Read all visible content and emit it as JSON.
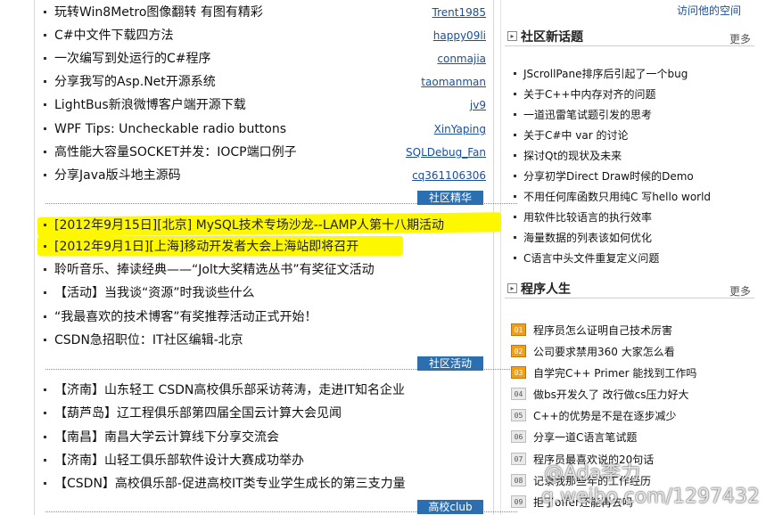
{
  "left_sections": [
    {
      "items": [
        {
          "title": "玩转Win8Metro图像翻转 有图有精彩",
          "author": "Trent1985"
        },
        {
          "title": "C#中文件下载四方法",
          "author": "happy09li"
        },
        {
          "title": "一次编写到处运行的C#程序",
          "author": "conmajia"
        },
        {
          "title": "分享我写的Asp.Net开源系统",
          "author": "taomanman"
        },
        {
          "title": "LightBus新浪微博客户端开源下载",
          "author": "jv9"
        },
        {
          "title": "WPF Tips: Uncheckable radio buttons",
          "author": "XinYaping"
        },
        {
          "title": "高性能大容量SOCKET并发：IOCP端口例子",
          "author": "SQLDebug_Fan"
        },
        {
          "title": "分享Java版斗地主源码",
          "author": "cq361106306"
        }
      ],
      "tab": "社区精华"
    },
    {
      "items": [
        {
          "title": "[2012年9月15日][北京] MySQL技术专场沙龙--LAMP人第十八期活动"
        },
        {
          "title": "[2012年9月1日][上海]移动开发者大会上海站即将召开"
        },
        {
          "title": "聆听音乐、捧读经典——“Jolt大奖精选丛书”有奖征文活动"
        },
        {
          "title": "【活动】当我谈“资源”时我谈些什么"
        },
        {
          "title": "“我最喜欢的技术博客”有奖推荐活动正式开始！"
        },
        {
          "title": "CSDN急招职位：IT社区编辑-北京"
        }
      ],
      "tab": "社区活动"
    },
    {
      "items": [
        {
          "title": "【济南】山东轻工 CSDN高校俱乐部采访蒋涛，走进IT知名企业"
        },
        {
          "title": "【葫芦岛】辽工程俱乐部第四届全国云计算大会见闻"
        },
        {
          "title": "【南昌】南昌大学云计算线下分享交流会"
        },
        {
          "title": "【济南】山轻工俱乐部软件设计大赛成功举办"
        },
        {
          "title": "【CSDN】高校俱乐部-促进高校IT类专业学生成长的第三支力量"
        }
      ],
      "tab": "高校club"
    }
  ],
  "right": {
    "visit_link": "访问他的空间",
    "panels": [
      {
        "title": "社区新话题",
        "more": "更多",
        "items": [
          "JScrollPane排序后引起了一个bug",
          "关于C++中内存对齐的问题",
          "一道迅雷笔试题引发的思考",
          "关于C#中 var 的讨论",
          "探讨Qt的现状及未来",
          "分享初学Direct Draw时候的Demo",
          "不用任何库函数只用纯C 写hello world",
          "用软件比较语言的执行效率",
          "海量数据的列表该如何优化",
          "C语言中头文件重复定义问题"
        ]
      },
      {
        "title": "程序人生",
        "more": "更多",
        "items": [
          {
            "rank": "01",
            "title": "程序员怎么证明自己技术厉害"
          },
          {
            "rank": "02",
            "title": "公司要求禁用360 大家怎么看"
          },
          {
            "rank": "03",
            "title": "自学完C++ Primer 能找到工作吗"
          },
          {
            "rank": "04",
            "title": "做bs开发久了 改行做cs压力好大"
          },
          {
            "rank": "05",
            "title": "C++的优势是不是在逐步减少"
          },
          {
            "rank": "06",
            "title": "分享一道C语言笔试题"
          },
          {
            "rank": "07",
            "title": "程序员最喜欢说的20句话"
          },
          {
            "rank": "08",
            "title": "记录我那些年的工作经历"
          },
          {
            "rank": "09",
            "title": "拒了offer还能再去吗"
          }
        ]
      }
    ]
  },
  "watermark": {
    "line1": "@Ada李力",
    "line2": "q.weibo.com/1297432"
  },
  "colors": {
    "highlight": "#fdf700",
    "tab_bg": "#2c6fb0",
    "link": "#1a4f9c",
    "rank_top": "#f0a018"
  }
}
